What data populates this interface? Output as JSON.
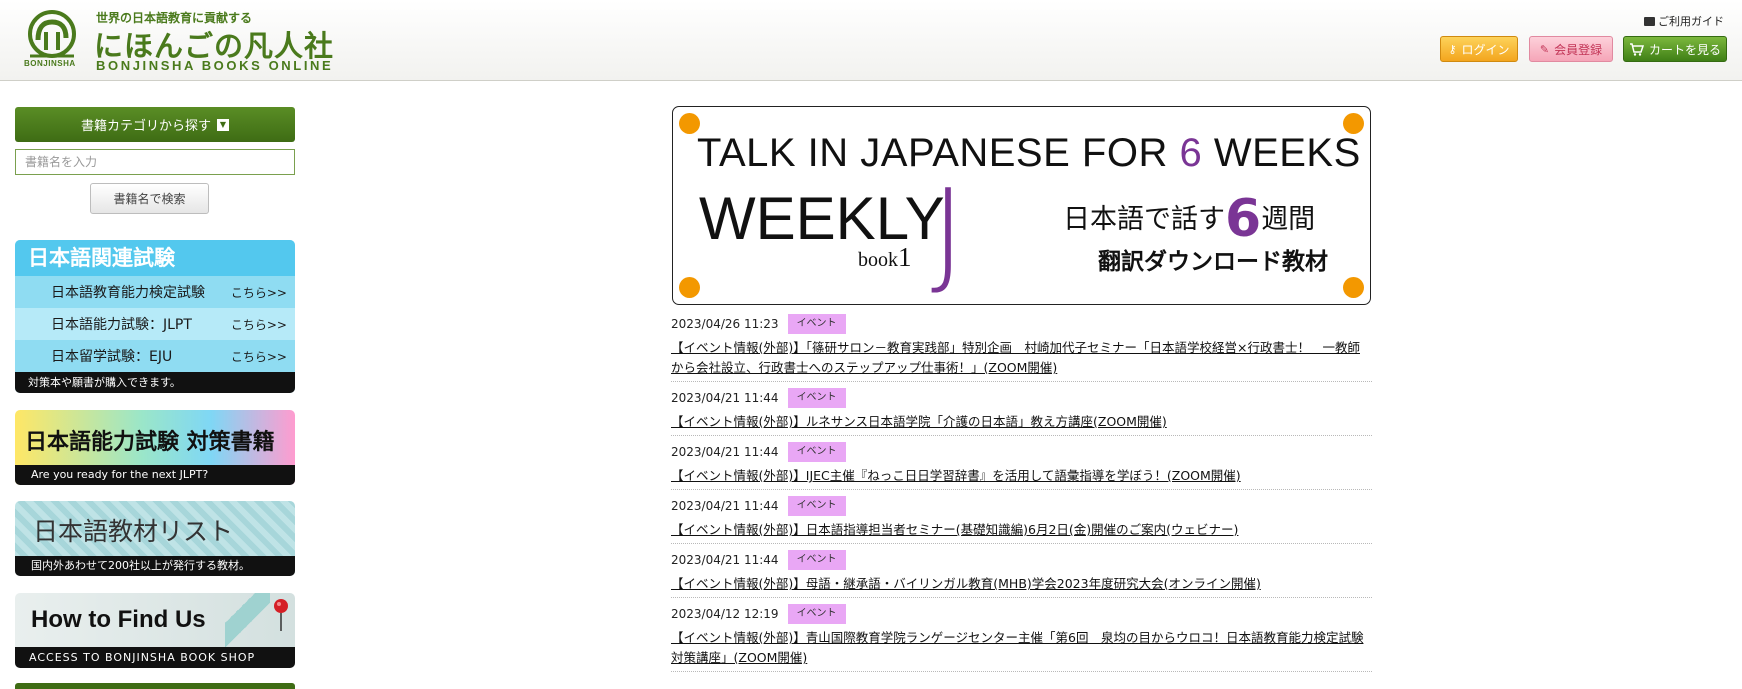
{
  "header": {
    "tagline": "世界の日本語教育に貢献する",
    "name": "にほんごの凡人社",
    "sub": "BONJINSHA BOOKS ONLINE",
    "logo_small": "BONJINSHA",
    "guide": "ご利用ガイド",
    "login": "ログイン",
    "register": "会員登録",
    "cart": "カートを見る",
    "colors": {
      "brand": "#4a7a1c",
      "login": "#f3a51e",
      "register": "#f5a5b8",
      "cart": "#3f7f16"
    }
  },
  "sidebar": {
    "category_button": "書籍カテゴリから探す",
    "search_placeholder": "書籍名を入力",
    "search_button": "書籍名で検索",
    "exam": {
      "title": "日本語関連試験",
      "items": [
        {
          "label": "日本語教育能力検定試験",
          "more": "こちら>>"
        },
        {
          "label": "日本語能力試験：JLPT",
          "more": "こちら>>"
        },
        {
          "label": "日本留学試験：EJU",
          "more": "こちら>>"
        }
      ],
      "footer": "対策本や願書が購入できます。"
    },
    "banner_jlpt": {
      "title": "日本語能力試験 対策書籍",
      "footer": "Are you ready for the next JLPT?"
    },
    "banner_list": {
      "title": "日本語教材リスト",
      "footer": "国内外あわせて200社以上が発行する教材。"
    },
    "banner_find": {
      "title": "How to Find Us",
      "footer": "ACCESS TO BONJINSHA BOOK SHOP"
    }
  },
  "hero": {
    "line1_pre": "TALK IN JAPANESE FOR ",
    "line1_num": "6",
    "line1_post": " WEEKS",
    "weekly": "WEEKLY",
    "book": "book",
    "book_no": "1",
    "letter": "J",
    "jp_pre": "日本語で話す",
    "jp_num": "6",
    "jp_post": "週間",
    "jp_sub": "翻訳ダウンロード教材",
    "accent": "#7a3595",
    "dot_color": "#f39800"
  },
  "news": [
    {
      "date": "2023/04/26 11:23",
      "tag": "イベント",
      "text": "【イベント情報(外部)】「篠研サロン－教育実践部」特別企画　村崎加代子セミナー「日本語学校経営×行政書士！　一教師から会社設立、行政書士へのステップアップ仕事術！」(ZOOM開催)"
    },
    {
      "date": "2023/04/21 11:44",
      "tag": "イベント",
      "text": "【イベント情報(外部)】ルネサンス日本語学院「介護の日本語」教え方講座(ZOOM開催)"
    },
    {
      "date": "2023/04/21 11:44",
      "tag": "イベント",
      "text": "【イベント情報(外部)】IJEC主催『ねっこ日日学習辞書』を活用して語彙指導を学ぼう！(ZOOM開催)"
    },
    {
      "date": "2023/04/21 11:44",
      "tag": "イベント",
      "text": "【イベント情報(外部)】日本語指導担当者セミナー(基礎知識編)6月2日(金)開催のご案内(ウェビナー)"
    },
    {
      "date": "2023/04/21 11:44",
      "tag": "イベント",
      "text": "【イベント情報(外部)】母語・継承語・バイリンガル教育(MHB)学会2023年度研究大会(オンライン開催)"
    },
    {
      "date": "2023/04/12 12:19",
      "tag": "イベント",
      "text": "【イベント情報(外部)】青山国際教育学院ランゲージセンター主催「第6回　泉均の目からウロコ！日本語教育能力検定試験対策講座」(ZOOM開催)"
    }
  ]
}
